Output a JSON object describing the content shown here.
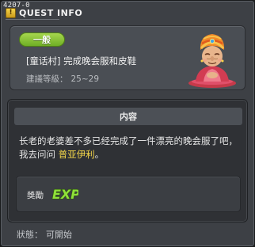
{
  "window": {
    "quest_id": "4207-0",
    "title": "QUEST INFO"
  },
  "header": {
    "badge": "一般",
    "quest_title": "[童话村] 完成晚会服和皮鞋",
    "level_label": "建議等級：",
    "level_value": "25~29",
    "npc_icon": "turban-old-woman-npc-portrait"
  },
  "content": {
    "section_title": "内容",
    "description_part1": "长老的老婆差不多已经完成了一件漂亮的晚会服了吧，我去问问",
    "description_npc": "普亚伊利",
    "description_part2": "。"
  },
  "reward": {
    "label": "獎勵",
    "icon": "exp-icon",
    "icon_text": "EXP"
  },
  "status": {
    "label": "狀態：",
    "value": "可開始"
  },
  "colors": {
    "badge_green": "#7cbc2d",
    "npc_highlight": "#f6d84a",
    "exp_green": "#8fe03a"
  }
}
